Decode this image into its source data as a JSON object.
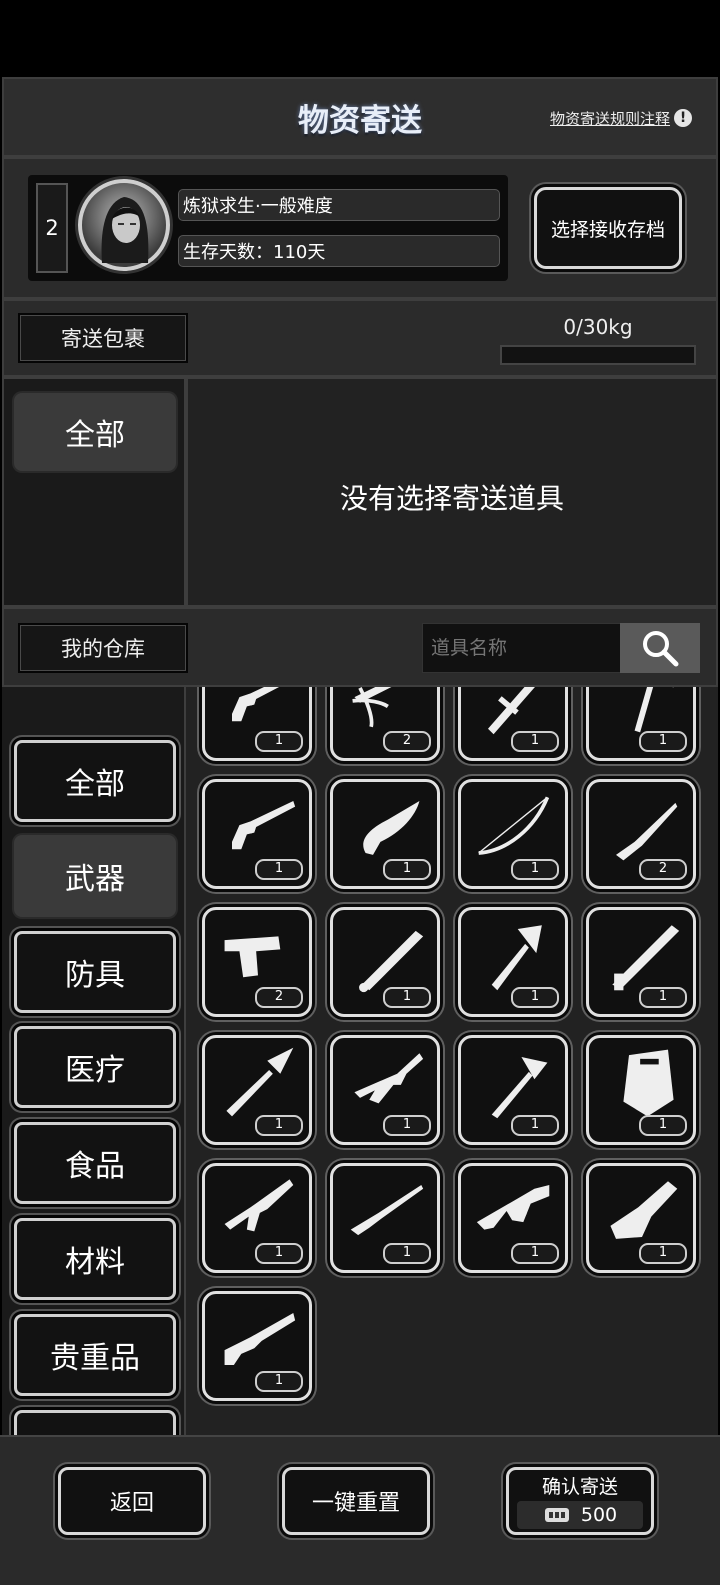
{
  "header": {
    "title": "物资寄送",
    "rules_link": "物资寄送规则注释"
  },
  "profile": {
    "slot_number": "2",
    "mode": "炼狱求生·一般难度",
    "days": "生存天数：110天",
    "select_button": "选择接收存档"
  },
  "package": {
    "label": "寄送包裹",
    "weight": "0/30kg",
    "weight_fraction": 0
  },
  "package_panel": {
    "category_all": "全部",
    "empty_message": "没有选择寄送道具"
  },
  "warehouse": {
    "label": "我的仓库",
    "search_placeholder": "道具名称"
  },
  "categories": [
    "全部",
    "武器",
    "防具",
    "医疗",
    "食品",
    "材料",
    "贵重品"
  ],
  "selected_category": "武器",
  "items": [
    {
      "icon": "revolver-icon",
      "qty": "1"
    },
    {
      "icon": "crossbow-icon",
      "qty": "2"
    },
    {
      "icon": "baton-icon",
      "qty": "1"
    },
    {
      "icon": "pickaxe-icon",
      "qty": "1"
    },
    {
      "icon": "revolver-icon",
      "qty": "1"
    },
    {
      "icon": "machete-icon",
      "qty": "1"
    },
    {
      "icon": "bow-icon",
      "qty": "1"
    },
    {
      "icon": "knife-icon",
      "qty": "2"
    },
    {
      "icon": "pistol-icon",
      "qty": "2"
    },
    {
      "icon": "bat-icon",
      "qty": "1"
    },
    {
      "icon": "axe-icon",
      "qty": "1"
    },
    {
      "icon": "sword-icon",
      "qty": "1"
    },
    {
      "icon": "spear-icon",
      "qty": "1"
    },
    {
      "icon": "rifle-icon",
      "qty": "1"
    },
    {
      "icon": "hatchet-icon",
      "qty": "1"
    },
    {
      "icon": "shield-icon",
      "qty": "1"
    },
    {
      "icon": "assault-rifle-icon",
      "qty": "1"
    },
    {
      "icon": "hunting-rifle-icon",
      "qty": "1"
    },
    {
      "icon": "grenade-launcher-icon",
      "qty": "1"
    },
    {
      "icon": "chainsaw-icon",
      "qty": "1"
    },
    {
      "icon": "shotgun-icon",
      "qty": "1"
    }
  ],
  "footer": {
    "back": "返回",
    "reset": "一键重置",
    "confirm": "确认寄送",
    "cost": "500"
  },
  "colors": {
    "background": "#000000",
    "panel": "#2b2b2b",
    "dark": "#181818",
    "border_light": "#e0e0e0"
  }
}
